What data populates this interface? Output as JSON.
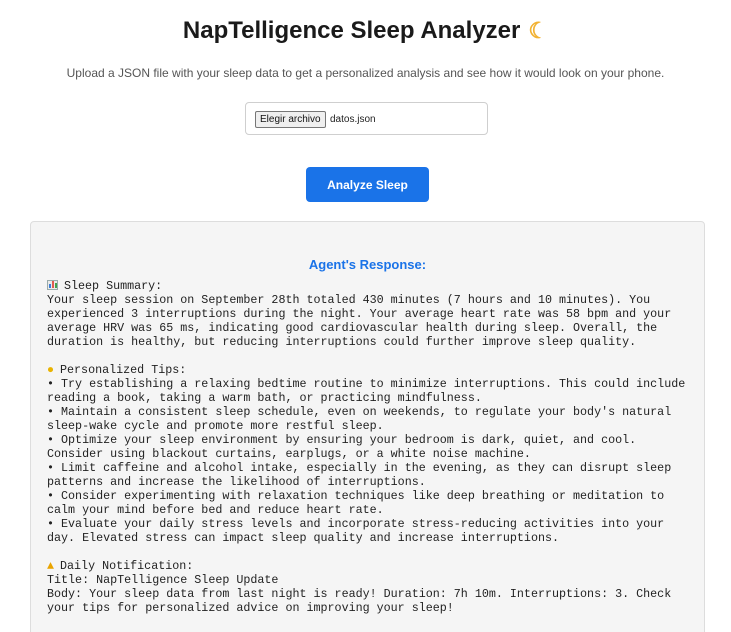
{
  "header": {
    "title": "NapTelligence Sleep Analyzer",
    "title_icon": "moon-icon",
    "subtitle": "Upload a JSON file with your sleep data to get a personalized analysis and see how it would look on your phone."
  },
  "upload": {
    "button_label": "Elegir archivo",
    "file_name": "datos.json"
  },
  "actions": {
    "analyze_label": "Analyze Sleep"
  },
  "response": {
    "heading": "Agent's Response:",
    "summary_title": "Sleep Summary:",
    "summary_body": "Your sleep session on September 28th totaled 430 minutes (7 hours and 10 minutes). You experienced 3 interruptions during the night. Your average heart rate was 58 bpm and your average HRV was 65 ms, indicating good cardiovascular health during sleep. Overall, the duration is healthy, but reducing interruptions could further improve sleep quality.",
    "tips_title": "Personalized Tips:",
    "tips": [
      "• Try establishing a relaxing bedtime routine to minimize interruptions. This could include reading a book, taking a warm bath, or practicing mindfulness.",
      "• Maintain a consistent sleep schedule, even on weekends, to regulate your body's natural sleep-wake cycle and promote more restful sleep.",
      "• Optimize your sleep environment by ensuring your bedroom is dark, quiet, and cool. Consider using blackout curtains, earplugs, or a white noise machine.",
      "• Limit caffeine and alcohol intake, especially in the evening, as they can disrupt sleep patterns and increase the likelihood of interruptions.",
      "• Consider experimenting with relaxation techniques like deep breathing or meditation to calm your mind before bed and reduce heart rate.",
      "• Evaluate your daily stress levels and incorporate stress-reducing activities into your day. Elevated stress can impact sleep quality and increase interruptions."
    ],
    "notification_title": "Daily Notification:",
    "notification_title_line": "Title: NapTelligence Sleep Update",
    "notification_body_line": "Body: Your sleep data from last night is ready! Duration: 7h 10m. Interruptions: 3. Check your tips for personalized advice on improving your sleep!"
  },
  "colors": {
    "primary": "#1a73e8",
    "panel_bg": "#f5f5f5",
    "moon": "#f2b233"
  }
}
